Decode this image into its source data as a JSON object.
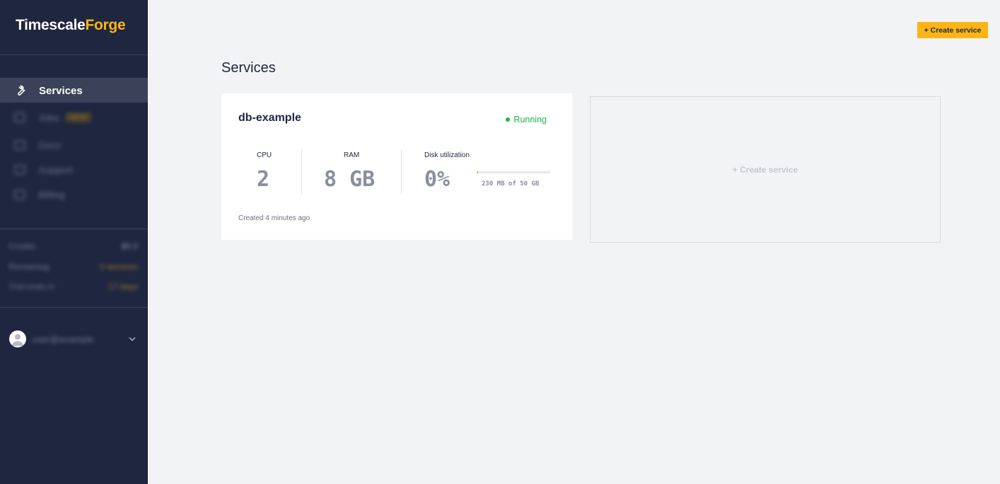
{
  "brand": {
    "part1": "Timescale",
    "part2": "Forge",
    "accent_color": "#fdb515"
  },
  "sidebar": {
    "active_item": {
      "label": "Services",
      "icon": "wrench-icon"
    },
    "blurred_items": [
      {
        "label": "Jobs",
        "icon": "box-icon",
        "badge": "NEW"
      },
      {
        "label": "Docs",
        "icon": "book-icon"
      },
      {
        "label": "Support",
        "icon": "support-icon"
      },
      {
        "label": "Billing",
        "icon": "card-icon"
      }
    ],
    "stats": [
      {
        "key": "Credits",
        "value": "$0.0"
      },
      {
        "key": "Remaining",
        "value": "0 services"
      },
      {
        "key": "Trial ends in",
        "value": "17 days"
      }
    ],
    "user": {
      "name": "user@example",
      "icon": "avatar-icon"
    }
  },
  "header": {
    "create_button": "+ Create service"
  },
  "main": {
    "title": "Services",
    "service_card": {
      "name": "db-example",
      "status": "Running",
      "status_color": "#23b34a",
      "cpu_label": "CPU",
      "cpu_value": "2",
      "ram_label": "RAM",
      "ram_value": "8 GB",
      "disk_label": "Disk utilization",
      "disk_value": "0%",
      "disk_fill_fraction": 0.02,
      "disk_detail": "230 MB of 50 GB",
      "created": "Created 4 minutes ago"
    },
    "create_card_label": "+ Create service"
  }
}
